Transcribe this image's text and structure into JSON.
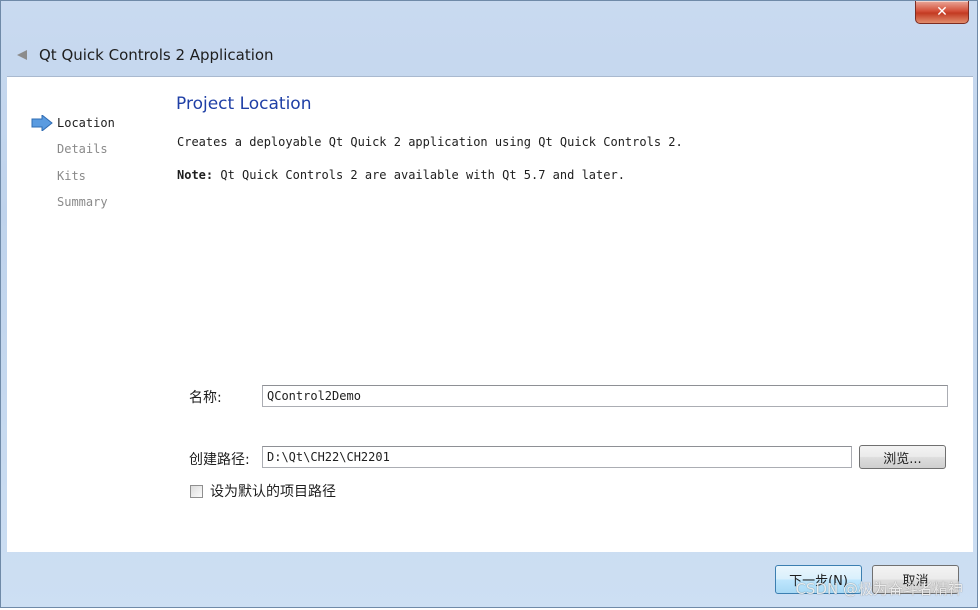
{
  "window": {
    "title": "Qt Quick Controls 2 Application",
    "close_glyph": "✕"
  },
  "steps": [
    {
      "label": "Location",
      "active": true
    },
    {
      "label": "Details",
      "active": false
    },
    {
      "label": "Kits",
      "active": false
    },
    {
      "label": "Summary",
      "active": false
    }
  ],
  "page": {
    "title": "Project Location",
    "description": "Creates a deployable Qt Quick 2 application using Qt Quick Controls 2.",
    "note_label": "Note:",
    "note_text": " Qt Quick Controls 2 are available with Qt 5.7 and later."
  },
  "form": {
    "name_label": "名称:",
    "name_value": "QControl2Demo",
    "path_label": "创建路径:",
    "path_value": "D:\\Qt\\CH22\\CH2201",
    "browse_label": "浏览...",
    "default_path_label": "设为默认的项目路径",
    "default_path_checked": false
  },
  "footer": {
    "next_label": "下一步(N)",
    "cancel_label": "取消"
  },
  "watermark": "CSDN @极为奋斗者精神",
  "colors": {
    "title_blue": "#1f3fa6",
    "step_arrow": "#4a90d9",
    "frame": "#c9daf0"
  }
}
